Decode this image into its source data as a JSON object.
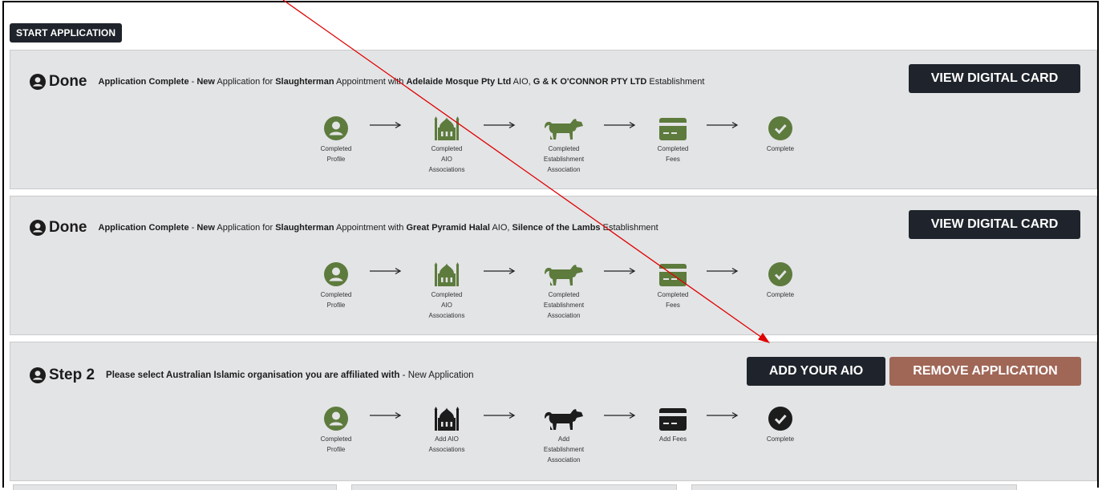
{
  "start_label": "START APPLICATION",
  "colors": {
    "green": "#5d7b3d",
    "dark": "#1f232b",
    "brown": "#a06656",
    "red_arrow": "#e00000"
  },
  "cards": [
    {
      "status": "Done",
      "desc": {
        "title": "Application Complete",
        "sep1": " - ",
        "new": "New",
        "t1": " Application for ",
        "role": "Slaughterman",
        "t2": " Appointment with ",
        "aio": "Adelaide Mosque Pty Ltd",
        "t3": " AIO, ",
        "est": "G & K O'CONNOR PTY LTD",
        "t4": " Establishment"
      },
      "button": "VIEW DIGITAL CARD",
      "steps": [
        {
          "icon": "user-icon",
          "label1": "Completed",
          "label2": "Profile",
          "label3": ""
        },
        {
          "icon": "mosque-icon",
          "label1": "Completed",
          "label2": "AIO",
          "label3": "Associations"
        },
        {
          "icon": "cow-icon",
          "label1": "Completed",
          "label2": "Establishment",
          "label3": "Association"
        },
        {
          "icon": "card-icon",
          "label1": "Completed",
          "label2": "Fees",
          "label3": ""
        },
        {
          "icon": "check-icon",
          "label1": "Complete",
          "label2": "",
          "label3": ""
        }
      ]
    },
    {
      "status": "Done",
      "desc": {
        "title": "Application Complete",
        "sep1": " - ",
        "new": "New",
        "t1": " Application for ",
        "role": "Slaughterman",
        "t2": " Appointment with ",
        "aio": "Great Pyramid Halal",
        "t3": " AIO, ",
        "est": "Silence of the Lambs",
        "t4": " Establishment"
      },
      "button": "VIEW DIGITAL CARD",
      "steps": [
        {
          "icon": "user-icon",
          "label1": "Completed",
          "label2": "Profile",
          "label3": ""
        },
        {
          "icon": "mosque-icon",
          "label1": "Completed",
          "label2": "AIO",
          "label3": "Associations"
        },
        {
          "icon": "cow-icon",
          "label1": "Completed",
          "label2": "Establishment",
          "label3": "Association"
        },
        {
          "icon": "card-icon",
          "label1": "Completed",
          "label2": "Fees",
          "label3": ""
        },
        {
          "icon": "check-icon",
          "label1": "Complete",
          "label2": "",
          "label3": ""
        }
      ]
    },
    {
      "status": "Step 2",
      "desc": {
        "title": "Please select Australian Islamic organisation you are affiliated with",
        "sep1": " - ",
        "rest": "New Application"
      },
      "button": "ADD YOUR AIO",
      "button2": "REMOVE APPLICATION",
      "steps": [
        {
          "icon": "user-icon",
          "label1": "Completed",
          "label2": "Profile",
          "label3": ""
        },
        {
          "icon": "mosque-icon",
          "label1": "Add AIO",
          "label2": "Associations",
          "label3": ""
        },
        {
          "icon": "cow-icon",
          "label1": "Add",
          "label2": "Establishment",
          "label3": "Association"
        },
        {
          "icon": "card-icon",
          "label1": "Add Fees",
          "label2": "",
          "label3": ""
        },
        {
          "icon": "check-icon",
          "label1": "Complete",
          "label2": "",
          "label3": ""
        }
      ]
    }
  ]
}
